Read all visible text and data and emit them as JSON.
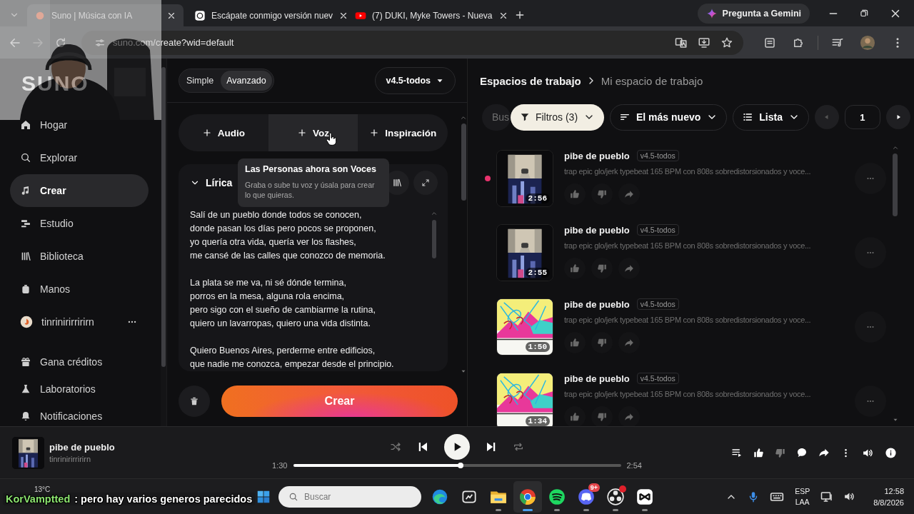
{
  "browser": {
    "tabs": [
      {
        "title": "Suno | Música con IA",
        "selected": true
      },
      {
        "title": "Escápate conmigo versión nuev",
        "selected": false
      },
      {
        "title": "(7) DUKI, Myke Towers - Nueva",
        "selected": false
      }
    ],
    "gemini_button": "Pregunta a Gemini",
    "url": "suno.com/create?wid=default"
  },
  "sidebar": {
    "logo": "SUNO",
    "items": [
      {
        "label": "Hogar",
        "kind": "link",
        "selected": false
      },
      {
        "label": "Explorar",
        "kind": "link",
        "selected": false
      },
      {
        "label": "Crear",
        "kind": "link",
        "selected": true
      },
      {
        "label": "Estudio",
        "kind": "link",
        "selected": false
      },
      {
        "label": "Biblioteca",
        "kind": "link",
        "selected": false
      },
      {
        "label": "Manos",
        "kind": "link",
        "selected": false
      },
      {
        "label": "tinrinirirririrn",
        "kind": "profile",
        "selected": false
      }
    ],
    "footer_items": [
      {
        "label": "Gana créditos"
      },
      {
        "label": "Laboratorios"
      },
      {
        "label": "Notificaciones"
      }
    ]
  },
  "create": {
    "modes": [
      {
        "label": "Simple",
        "selected": false
      },
      {
        "label": "Avanzado",
        "selected": true
      }
    ],
    "model": "v4.5-todos",
    "add_buttons": [
      {
        "label": "Audio",
        "hovered": false
      },
      {
        "label": "Voz",
        "hovered": true
      },
      {
        "label": "Inspiración",
        "hovered": false
      }
    ],
    "tooltip": {
      "title": "Las Personas ahora son Voces",
      "text": "Graba o sube tu voz y úsala para crear lo que quieras."
    },
    "lyrics": {
      "title": "Lírica",
      "expanded": true,
      "stanzas": [
        [
          "Salí de un pueblo donde todos se conocen,",
          "donde pasan los días pero pocos se proponen,",
          "yo quería otra vida, quería ver los flashes,",
          "me cansé de las calles que conozco de memoria."
        ],
        [
          "La plata se me va, ni sé dónde termina,",
          "porros en la mesa, alguna rola encima,",
          "pero sigo con el sueño de cambiarme la rutina,",
          "quiero un lavarropas, quiero una vida distinta."
        ],
        [
          "Quiero Buenos Aires, perderme entre edificios,",
          "que nadie me conozca, empezar desde el principio."
        ]
      ]
    },
    "create_button": "Crear"
  },
  "workspace": {
    "breadcrumb": [
      "Espacios de trabajo",
      "Mi espacio de trabajo"
    ],
    "search_placeholder": "Bus",
    "filters": "Filtros (3)",
    "sort": "El más nuevo",
    "view": "Lista",
    "page": "1",
    "songs": [
      {
        "title": "pibe de pueblo",
        "version": "v4.5-todos",
        "description": "trap epic glo/jerk typebeat 165 BPM con 808s sobredistorsionados y voce...",
        "duration": "2:56",
        "playing": true
      },
      {
        "title": "pibe de pueblo",
        "version": "v4.5-todos",
        "description": "trap epic glo/jerk typebeat 165 BPM con 808s sobredistorsionados y voce...",
        "duration": "2:55",
        "playing": false
      },
      {
        "title": "pibe de pueblo",
        "version": "v4.5-todos",
        "description": "trap epic glo/jerk typebeat 165 BPM con 808s sobredistorsionados y voce...",
        "duration": "1:50",
        "playing": false
      },
      {
        "title": "pibe de pueblo",
        "version": "v4.5-todos",
        "description": "trap epic glo/jerk typebeat 165 BPM con 808s sobredistorsionados y voce...",
        "duration": "1:34",
        "playing": false
      }
    ]
  },
  "player": {
    "title": "pibe de pueblo",
    "artist": "tinrinirirririrn",
    "playing": false,
    "elapsed": "1:30",
    "level": 0.51,
    "total": "2:54"
  },
  "taskbar": {
    "weather": "13°C",
    "search_placeholder": "Buscar",
    "apps": [
      {
        "kind": "edge",
        "running": false,
        "selected": false
      },
      {
        "kind": "app",
        "running": false,
        "selected": false
      },
      {
        "kind": "folder",
        "running": true,
        "selected": false
      },
      {
        "kind": "chrome",
        "running": true,
        "selected": true
      },
      {
        "kind": "spotify",
        "running": true,
        "selected": false
      },
      {
        "kind": "discord",
        "running": true,
        "selected": false,
        "badge": "9+"
      },
      {
        "kind": "obs",
        "running": true,
        "selected": false,
        "alert": true
      },
      {
        "kind": "capcut",
        "running": true,
        "selected": false
      }
    ],
    "language": [
      "ESP",
      "LAA"
    ],
    "time": "12:58",
    "date": "8/8/2026"
  },
  "chat_overlay": {
    "user": "KorVamptted",
    "message": ": pero hay varios generos parecidos"
  }
}
